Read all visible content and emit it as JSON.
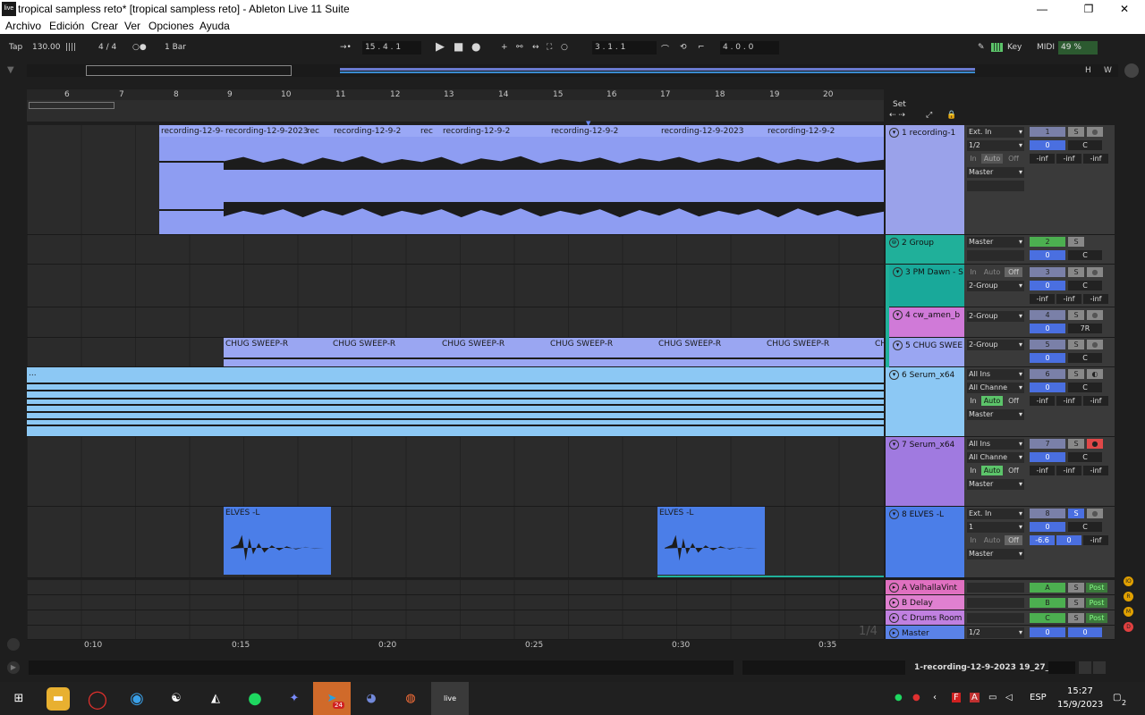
{
  "window": {
    "title": "tropical sampless reto*  [tropical sampless reto] - Ableton Live 11 Suite",
    "logo": "live",
    "minimize": "—",
    "maximize": "❐",
    "close": "✕"
  },
  "menu": [
    "Archivo",
    "Edición",
    "Crear",
    "Ver",
    "Opciones",
    "Ayuda"
  ],
  "control": {
    "tap": "Tap",
    "tempo": "130.00",
    "nudge": "||||",
    "signature": "4 / 4",
    "metro": "○●",
    "quantize": "1 Bar",
    "follow": "→•",
    "position": "15 .  4 .  1",
    "punch_in": "3 .  1 .  1",
    "loop_len": "4 .  0 .  0",
    "key": "Key",
    "midi": "MIDI",
    "cpu": "49 %",
    "draw": "✎"
  },
  "overview_buttons": {
    "h": "H",
    "w": "W"
  },
  "ruler": [
    "6",
    "7",
    "8",
    "9",
    "10",
    "11",
    "12",
    "13",
    "14",
    "15",
    "16",
    "17",
    "18",
    "19",
    "20"
  ],
  "set": {
    "label": "Set"
  },
  "tracks": [
    {
      "name": "1 recording-1",
      "color": "#9aa2ea",
      "clip_color": "#8e9df2",
      "input": "Ext. In",
      "channel": "1/2",
      "mon_in": "In",
      "mon_auto": "Auto",
      "mon_off": "Off",
      "out": "Master",
      "num": "1",
      "s": "S",
      "pan": "0",
      "c": "C",
      "vol": [
        "-inf",
        "-inf",
        "-inf"
      ],
      "clips": [
        "recording-12-9-",
        "recording-12-9-2023",
        "rec",
        "recording-12-9-2",
        "rec",
        "rec",
        "recording-12-9-2",
        "recording-12-9-2",
        "rec",
        "recording-12-9-2023",
        "rec",
        "recording-12-9-2"
      ]
    },
    {
      "name": "2 Group",
      "color": "#20b09a",
      "out": "Master",
      "num": "2",
      "s": "S",
      "pan": "0",
      "c": "C"
    },
    {
      "name": "3 PM Dawn - S",
      "color": "#19a99a",
      "mon_in": "In",
      "mon_auto": "Auto",
      "mon_off": "Off",
      "out": "2-Group",
      "num": "3",
      "s": "S",
      "pan": "0",
      "c": "C",
      "vol": [
        "-inf",
        "-inf",
        "-inf"
      ]
    },
    {
      "name": "4 cw_amen_b",
      "color": "#d07ad8",
      "out": "2-Group",
      "num": "4",
      "s": "S",
      "pan": "0",
      "c": "7R"
    },
    {
      "name": "5 CHUG SWEE",
      "color": "#9aa6f2",
      "out": "2-Group",
      "num": "5",
      "s": "S",
      "pan": "0",
      "c": "C",
      "clips": [
        "CHUG SWEEP-R",
        "CHUG SWEEP-R",
        "CHUG SWEEP-R",
        "CHUG SWEEP-R",
        "CHUG SWEEP-R",
        "CHUG SWEEP-R",
        "CH"
      ]
    },
    {
      "name": "6 Serum_x64",
      "color": "#8cc8f4",
      "input": "All Ins",
      "channel": "All Channe",
      "mon_in": "In",
      "mon_auto": "Auto",
      "mon_off": "Off",
      "out": "Master",
      "num": "6",
      "s": "S",
      "pan": "0",
      "c": "C",
      "vol": [
        "-inf",
        "-inf",
        "-inf"
      ],
      "clip_label": "..."
    },
    {
      "name": "7 Serum_x64",
      "color": "#a07ae0",
      "input": "All Ins",
      "channel": "All Channe",
      "mon_in": "In",
      "mon_auto": "Auto",
      "mon_off": "Off",
      "out": "Master",
      "num": "7",
      "s": "S",
      "pan": "0",
      "c": "C",
      "vol": [
        "-inf",
        "-inf",
        "-inf"
      ]
    },
    {
      "name": "8 ELVES    -L",
      "color": "#4b7ee8",
      "input": "Ext. In",
      "channel": "1",
      "mon_in": "In",
      "mon_auto": "Auto",
      "mon_off": "Off",
      "out": "Master",
      "num": "8",
      "s": "S",
      "pan": "0",
      "c": "C",
      "vol": [
        "-6.6",
        "0",
        "-inf"
      ],
      "clips": [
        "ELVES    -L",
        "ELVES    -L"
      ]
    }
  ],
  "returns": [
    {
      "name": "A ValhallaVint",
      "color": "#e070c0",
      "letter": "A",
      "s": "S",
      "post": "Post"
    },
    {
      "name": "B Delay",
      "color": "#e080d0",
      "letter": "B",
      "s": "S",
      "post": "Post"
    },
    {
      "name": "C Drums Room",
      "color": "#c080e0",
      "letter": "C",
      "s": "S",
      "post": "Post"
    }
  ],
  "master": {
    "name": "Master",
    "out": "1/2",
    "pan": "0",
    "vol": "0"
  },
  "sig_marker": "1/4",
  "timeline": [
    "0:10",
    "0:15",
    "0:20",
    "0:25",
    "0:30",
    "0:35"
  ],
  "status": {
    "clip": "1-recording-12-9-2023 19_27_59"
  },
  "right_dots": [
    "IO",
    "R",
    "M",
    "D"
  ],
  "taskbar": {
    "lang": "ESP",
    "time": "15:27",
    "date": "15/9/2023",
    "badge": "24",
    "notif": "2"
  }
}
